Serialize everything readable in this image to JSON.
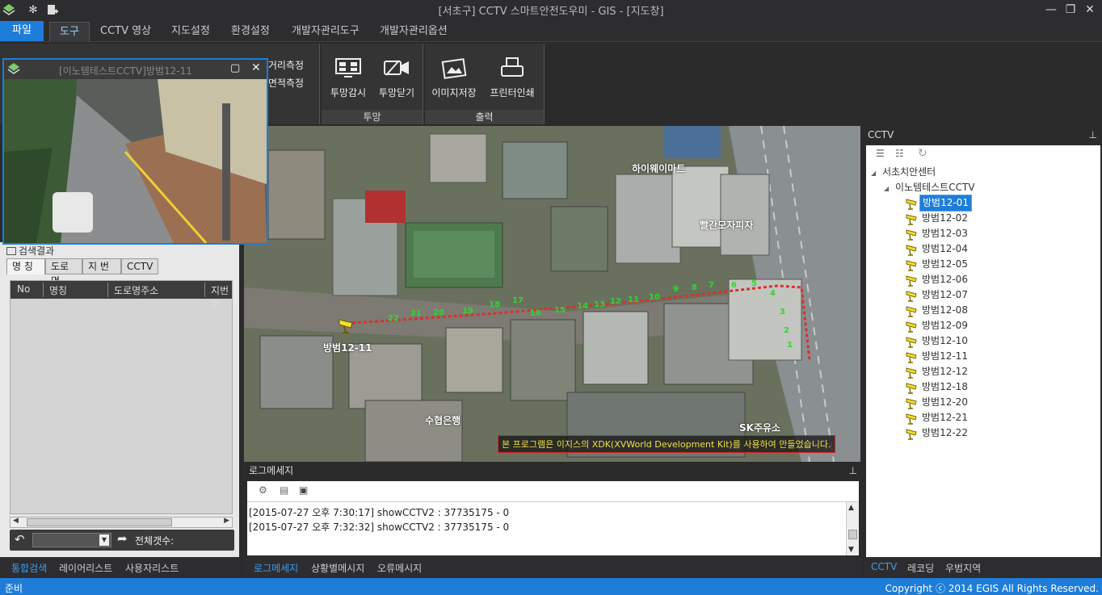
{
  "window": {
    "title": "[서초구]  CCTV 스마트안전도우미  - GIS - [지도창]"
  },
  "menu": {
    "file": "파일",
    "tabs": [
      "도구",
      "CCTV 영상",
      "지도설정",
      "환경설정",
      "개발자관리도구",
      "개발자관리옵션"
    ]
  },
  "ribbon": {
    "measure_distance": "거리측정",
    "measure_area": "면적측정",
    "perspective_watch": "투망감시",
    "perspective_close": "투망닫기",
    "perspective_group": "투망",
    "save_image": "이미지저장",
    "print": "프린터인쇄",
    "output_group": "출력"
  },
  "video_popup": {
    "title": "[이노템테스트CCTV]방범12-11"
  },
  "left_panel": {
    "result_title": "검색결과",
    "tabs": [
      "명 칭",
      "도로명",
      "지 번",
      "CCTV"
    ],
    "columns": [
      "No",
      "명칭",
      "도로명주소",
      "지번주"
    ],
    "total_label": "전체갯수:"
  },
  "left_bottom_tabs": [
    "통합검색",
    "레이어리스트",
    "사용자리스트"
  ],
  "map": {
    "labels": {
      "hyemart": "하이웨이마트",
      "pizza": "빨간모자피자",
      "bank": "수협은행",
      "gas": "SK주유소",
      "camera": "방범12-11"
    },
    "route_numbers": [
      "22",
      "21",
      "20",
      "19",
      "18",
      "17",
      "16",
      "15",
      "14",
      "13",
      "12",
      "11",
      "10",
      "9",
      "8",
      "7",
      "6",
      "5",
      "4",
      "3",
      "2",
      "1"
    ],
    "notice": "본 프로그램은 이지스의 XDK(XVWorld Development Kit)를 사용하여 만들었습니다."
  },
  "log": {
    "title": "로그메세지",
    "lines": [
      "[2015-07-27 오후 7:30:17] showCCTV2 : 37735175 - 0",
      "[2015-07-27 오후 7:32:32] showCCTV2 : 37735175 - 0"
    ],
    "tabs": [
      "로그메세지",
      "상황별메시지",
      "오류메시지"
    ]
  },
  "cctv_panel": {
    "title": "CCTV",
    "root": "서초치안센터",
    "group": "이노템테스트CCTV",
    "items": [
      "방범12-01",
      "방범12-02",
      "방범12-03",
      "방범12-04",
      "방범12-05",
      "방범12-06",
      "방범12-07",
      "방범12-08",
      "방범12-09",
      "방범12-10",
      "방범12-11",
      "방범12-12",
      "방범12-18",
      "방범12-20",
      "방범12-21",
      "방범12-22"
    ],
    "selected_index": 0,
    "tabs": [
      "CCTV",
      "레코딩",
      "우범지역"
    ]
  },
  "status": {
    "left": "준비",
    "right": "Copyright ⓒ 2014 EGIS All Rights Reserved."
  },
  "colors": {
    "accent": "#1e7dd8",
    "route": "#d9302a",
    "route_labels": "#2fd82f",
    "notice_text": "#f0e040"
  }
}
